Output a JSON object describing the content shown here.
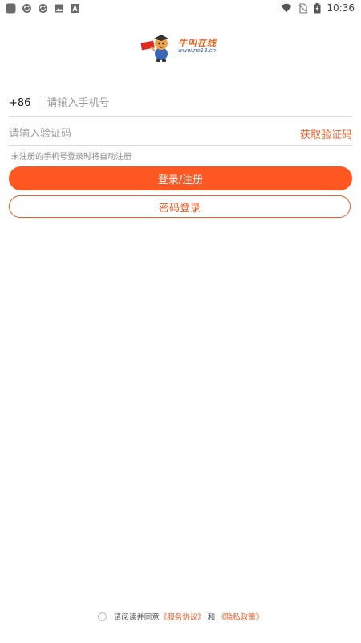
{
  "status_bar": {
    "time": "10:36",
    "left_icons": [
      "app-icon",
      "sync-icon",
      "sync-icon",
      "image-icon",
      "text-icon"
    ],
    "right_icons": [
      "wifi-icon",
      "no-sim-icon",
      "battery-icon"
    ]
  },
  "logo": {
    "title": "牛叫在线",
    "url": "www.no18.cn"
  },
  "form": {
    "country_code": "+86",
    "phone_placeholder": "请输入手机号",
    "code_placeholder": "请输入验证码",
    "get_code_label": "获取验证码",
    "hint": "未注册的手机号登录时将自动注册",
    "login_register_label": "登录/注册",
    "password_login_label": "密码登录"
  },
  "agreement": {
    "prefix": "请阅读并同意",
    "service_link": "《服务协议》",
    "and": "和",
    "privacy_link": "《隐私政策》"
  },
  "colors": {
    "accent": "#ff5722",
    "link": "#f15a24"
  }
}
